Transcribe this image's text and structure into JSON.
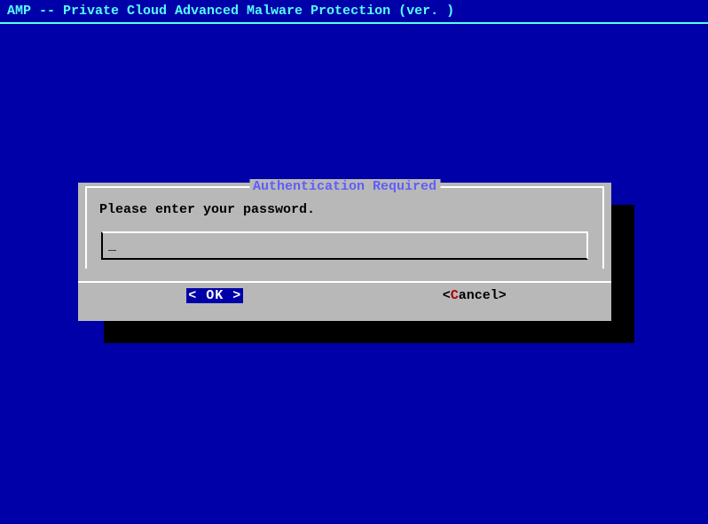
{
  "header": {
    "title": "AMP -- Private Cloud Advanced Malware Protection (ver. )"
  },
  "dialog": {
    "title": " Authentication Required ",
    "message": "Please enter your password.",
    "input_value": "_",
    "buttons": {
      "ok_open": "<",
      "ok_label": " OK ",
      "ok_close": ">",
      "cancel_open": "<",
      "cancel_hotkey": "C",
      "cancel_rest": "ancel",
      "cancel_close": ">"
    }
  }
}
